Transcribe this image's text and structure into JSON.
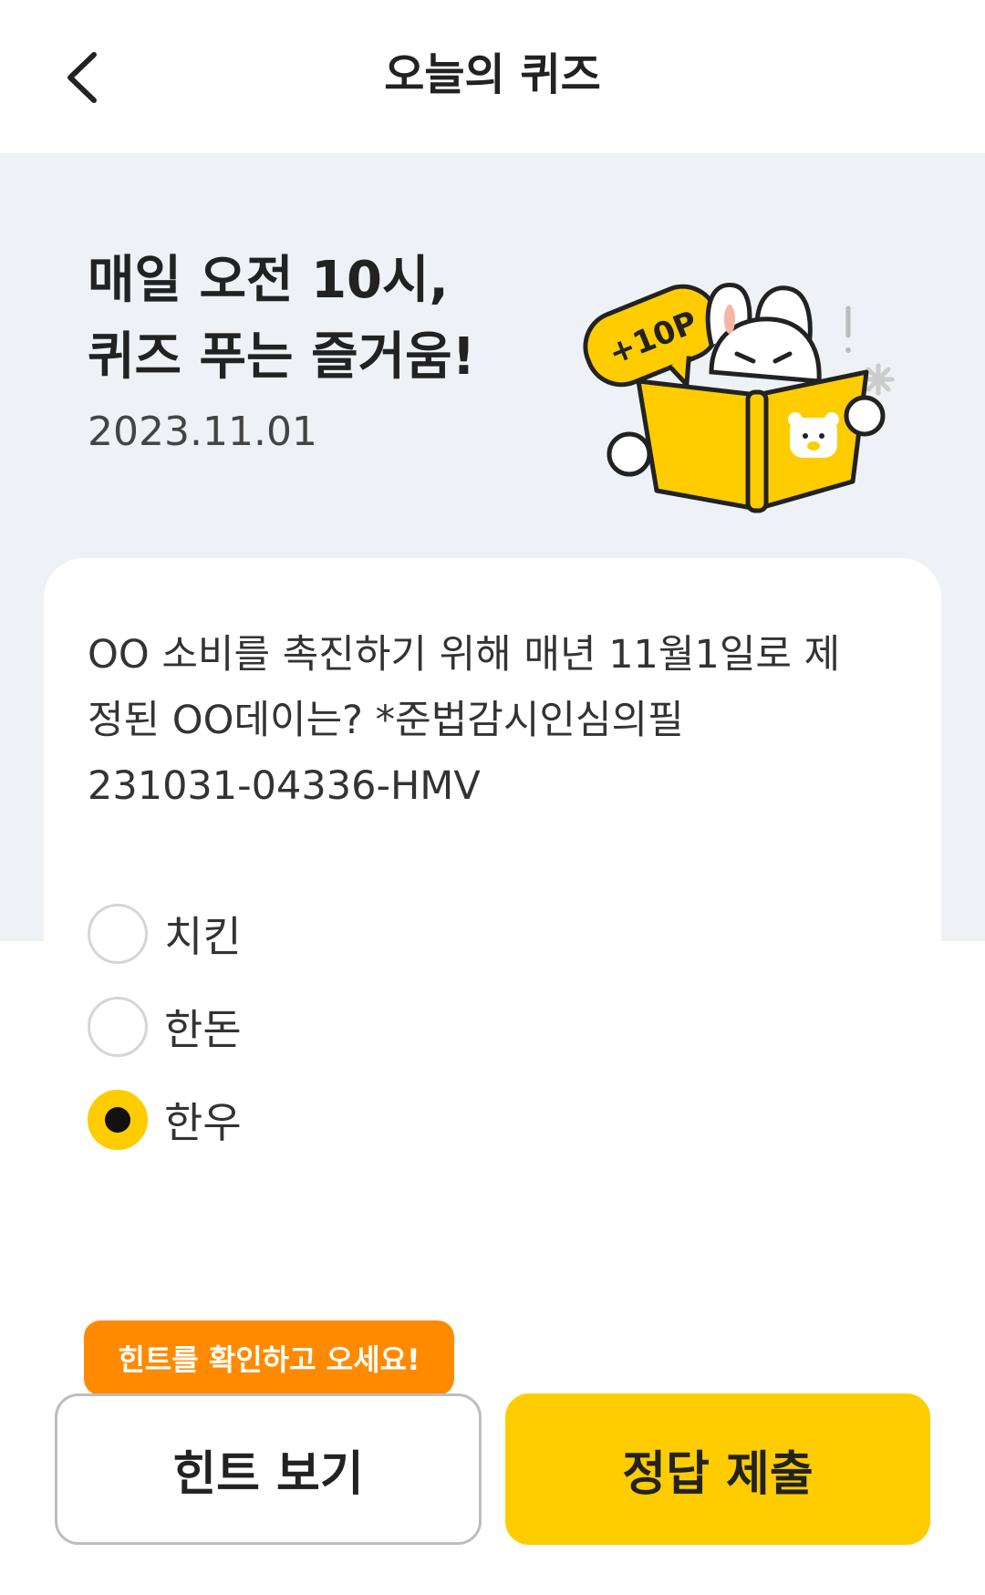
{
  "header": {
    "title": "오늘의 퀴즈",
    "back_icon": "chevron-left-icon"
  },
  "hero": {
    "line1": "매일 오전 10시,",
    "line2": "퀴즈 푸는 즐거움!",
    "date": "2023.11.01",
    "badge": "+10P"
  },
  "quiz": {
    "question_lines": [
      "OO 소비를 촉진하기 위해 매년 11월1일로 제",
      "정된 OO데이는? *준법감시인심의필",
      "231031-04336-HMV"
    ],
    "options": [
      {
        "label": "치킨",
        "selected": false
      },
      {
        "label": "한돈",
        "selected": false
      },
      {
        "label": "한우",
        "selected": true
      }
    ]
  },
  "actions": {
    "tooltip": "힌트를 확인하고 오세요!",
    "hint_label": "힌트 보기",
    "submit_label": "정답 제출"
  },
  "colors": {
    "accent": "#ffcc00",
    "tooltip": "#ff8a00",
    "hero_bg": "#eef1f6"
  }
}
